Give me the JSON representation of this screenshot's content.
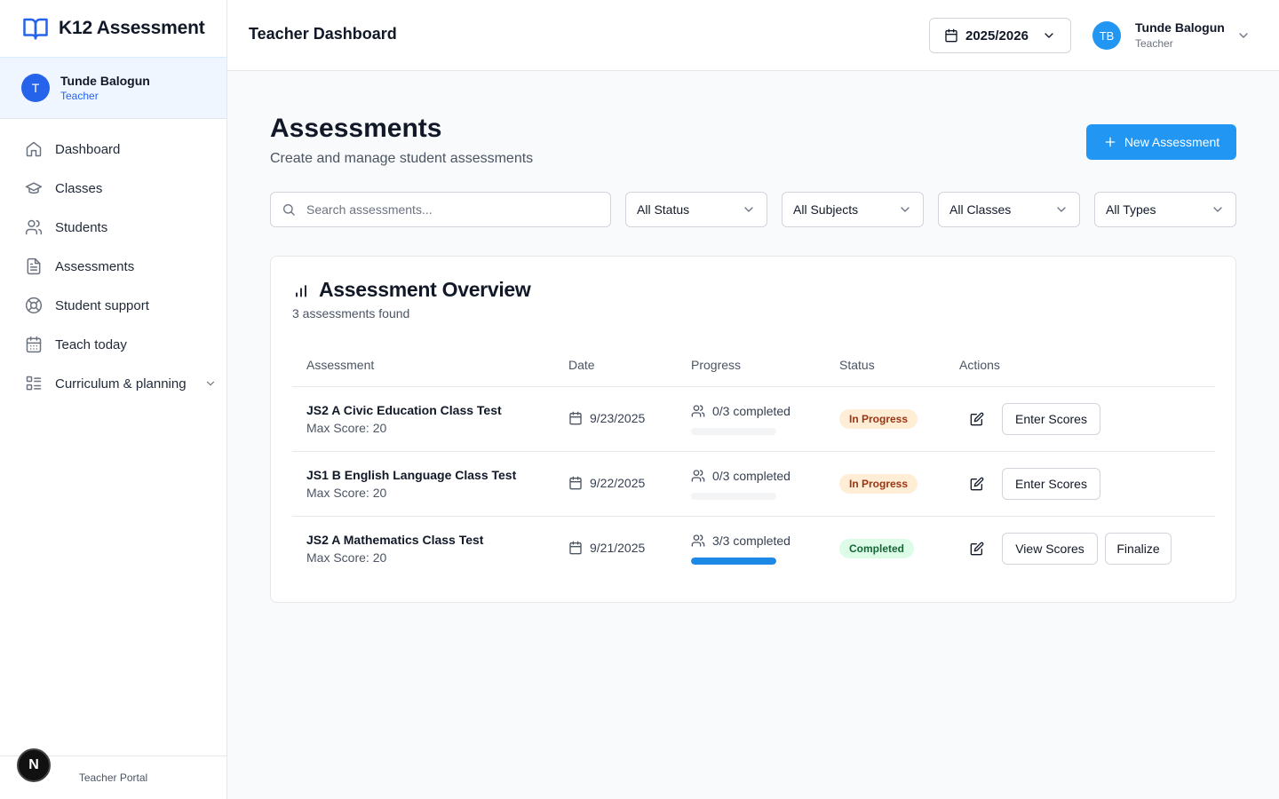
{
  "colors": {
    "accent": "#2196f3",
    "brand_blue": "#2563eb",
    "in_progress_bg": "#ffedd5",
    "in_progress_fg": "#9a3412",
    "completed_bg": "#dcfce7",
    "completed_fg": "#166534"
  },
  "sidebar": {
    "brand_title": "K12 Assessment",
    "user": {
      "initial": "T",
      "name": "Tunde Balogun",
      "role": "Teacher"
    },
    "items": [
      {
        "label": "Dashboard",
        "icon": "home-icon"
      },
      {
        "label": "Classes",
        "icon": "graduation-cap-icon"
      },
      {
        "label": "Students",
        "icon": "users-icon"
      },
      {
        "label": "Assessments",
        "icon": "file-text-icon"
      },
      {
        "label": "Student support",
        "icon": "life-buoy-icon"
      },
      {
        "label": "Teach today",
        "icon": "calendar-icon"
      },
      {
        "label": "Curriculum & planning",
        "icon": "list-icon"
      }
    ],
    "footer": "Teacher Portal",
    "dev_badge": "N"
  },
  "header": {
    "title": "Teacher Dashboard",
    "year": "2025/2026",
    "user": {
      "initials": "TB",
      "name": "Tunde Balogun",
      "role": "Teacher"
    }
  },
  "main": {
    "title": "Assessments",
    "subtitle": "Create and manage student assessments",
    "new_button": "New Assessment",
    "search_placeholder": "Search assessments...",
    "filters": [
      "All Status",
      "All Subjects",
      "All Classes",
      "All Types"
    ]
  },
  "overview": {
    "title": "Assessment Overview",
    "count_text": "3 assessments found",
    "columns": [
      "Assessment",
      "Date",
      "Progress",
      "Status",
      "Actions"
    ],
    "rows": [
      {
        "name": "JS2 A Civic Education Class Test",
        "max": "Max Score: 20",
        "date": "9/23/2025",
        "progress": "0/3 completed",
        "progress_fraction": 0,
        "status": "In Progress",
        "actions": [
          "Enter Scores"
        ]
      },
      {
        "name": "JS1 B English Language Class Test",
        "max": "Max Score: 20",
        "date": "9/22/2025",
        "progress": "0/3 completed",
        "progress_fraction": 0,
        "status": "In Progress",
        "actions": [
          "Enter Scores"
        ]
      },
      {
        "name": "JS2 A Mathematics Class Test",
        "max": "Max Score: 20",
        "date": "9/21/2025",
        "progress": "3/3 completed",
        "progress_fraction": 1,
        "status": "Completed",
        "actions": [
          "View Scores",
          "Finalize"
        ]
      }
    ]
  }
}
